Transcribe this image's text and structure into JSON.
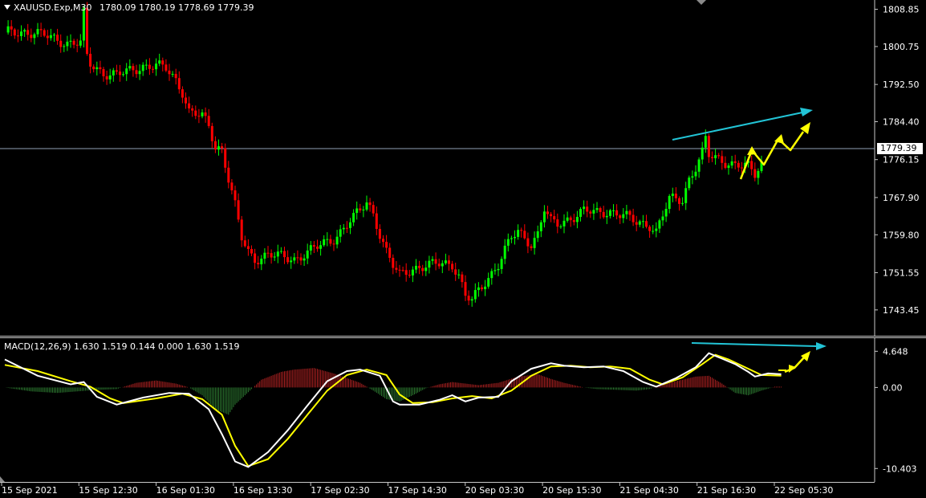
{
  "header": {
    "symbol_label": "XAUUSD.Exp,M30",
    "ohlc_label": "1780.09 1780.19 1778.69 1779.39"
  },
  "current_price_label": "1779.39",
  "macd_label": "MACD(12,26,9) 1.630 1.519 0.144 0.000 1.630 1.519",
  "colors": {
    "background": "#000000",
    "bull_candle": "#00ff00",
    "bear_candle": "#ff0000",
    "macd_line": "#ffffff",
    "signal_line": "#ffff00",
    "hist_positive": "#b22222",
    "hist_negative": "#2e7d32",
    "arrow_cyan": "#22c4d6",
    "arrow_yellow": "#ffff00",
    "price_line": "#8fa0b4"
  },
  "chart_data": [
    {
      "type": "candlestick",
      "title": "XAUUSD.Exp,M30",
      "y_ticks": [
        "1808.85",
        "1800.75",
        "1792.50",
        "1784.40",
        "1776.15",
        "1767.90",
        "1759.80",
        "1751.55",
        "1743.45"
      ],
      "ylim": [
        1741.5,
        1810.0
      ],
      "x_ticks": [
        "15 Sep 2021",
        "15 Sep 12:30",
        "16 Sep 01:30",
        "16 Sep 13:30",
        "17 Sep 02:30",
        "17 Sep 14:30",
        "20 Sep 03:30",
        "20 Sep 15:30",
        "21 Sep 04:30",
        "21 Sep 16:30",
        "22 Sep 05:30"
      ],
      "close_path": [
        [
          0,
          1803.8
        ],
        [
          6,
          1804.0
        ],
        [
          12,
          1803.2
        ],
        [
          19,
          1801.5
        ],
        [
          23,
          1801.5
        ],
        [
          24,
          1807.8
        ],
        [
          25,
          1798.5
        ],
        [
          26,
          1797.0
        ],
        [
          30,
          1795.0
        ],
        [
          34,
          1794.5
        ],
        [
          38,
          1795.5
        ],
        [
          42,
          1796.5
        ],
        [
          46,
          1796.5
        ],
        [
          49,
          1796.0
        ],
        [
          52,
          1793.5
        ],
        [
          54,
          1791.0
        ],
        [
          56,
          1786.5
        ],
        [
          60,
          1785.5
        ],
        [
          62,
          1783.5
        ],
        [
          64,
          1779.0
        ],
        [
          66,
          1778.5
        ],
        [
          68,
          1772.0
        ],
        [
          70,
          1766.0
        ],
        [
          72,
          1759.0
        ],
        [
          74,
          1756.0
        ],
        [
          76,
          1754.5
        ],
        [
          80,
          1755.5
        ],
        [
          84,
          1755.0
        ],
        [
          88,
          1754.5
        ],
        [
          92,
          1756.0
        ],
        [
          96,
          1757.5
        ],
        [
          100,
          1759.0
        ],
        [
          104,
          1762.0
        ],
        [
          108,
          1765.0
        ],
        [
          110,
          1767.0
        ],
        [
          112,
          1764.5
        ],
        [
          114,
          1760.0
        ],
        [
          116,
          1756.0
        ],
        [
          118,
          1753.0
        ],
        [
          120,
          1751.0
        ],
        [
          124,
          1752.5
        ],
        [
          128,
          1753.0
        ],
        [
          132,
          1753.5
        ],
        [
          136,
          1753.5
        ],
        [
          138,
          1751.0
        ],
        [
          140,
          1746.5
        ],
        [
          142,
          1745.5
        ],
        [
          144,
          1747.5
        ],
        [
          146,
          1749.5
        ],
        [
          148,
          1751.5
        ],
        [
          150,
          1753.5
        ],
        [
          152,
          1756.5
        ],
        [
          154,
          1759.0
        ],
        [
          156,
          1760.5
        ],
        [
          158,
          1759.0
        ],
        [
          160,
          1758.0
        ],
        [
          162,
          1760.0
        ],
        [
          164,
          1765.5
        ],
        [
          166,
          1762.5
        ],
        [
          168,
          1762.0
        ],
        [
          172,
          1763.5
        ],
        [
          176,
          1765.0
        ],
        [
          180,
          1764.5
        ],
        [
          184,
          1765.0
        ],
        [
          188,
          1764.0
        ],
        [
          192,
          1762.5
        ],
        [
          196,
          1762.0
        ],
        [
          198,
          1760.5
        ],
        [
          200,
          1764.0
        ],
        [
          202,
          1767.5
        ],
        [
          206,
          1767.5
        ],
        [
          208,
          1772.0
        ],
        [
          210,
          1774.5
        ],
        [
          212,
          1777.5
        ],
        [
          213,
          1780.5
        ],
        [
          214,
          1777.0
        ],
        [
          218,
          1776.0
        ],
        [
          222,
          1775.0
        ],
        [
          226,
          1774.5
        ],
        [
          228,
          1773.0
        ],
        [
          230,
          1775.5
        ]
      ]
    },
    {
      "type": "macd",
      "title": "MACD(12,26,9) 1.630 1.519 0.144 0.000 1.630 1.519",
      "y_ticks": [
        "4.648",
        "0.00",
        "-10.403"
      ],
      "ylim": [
        -11.2,
        5.3
      ],
      "macd": [
        [
          0,
          3.6
        ],
        [
          10,
          1.5
        ],
        [
          20,
          0.4
        ],
        [
          24,
          0.7
        ],
        [
          28,
          -1.2
        ],
        [
          34,
          -2.2
        ],
        [
          42,
          -1.3
        ],
        [
          50,
          -0.7
        ],
        [
          56,
          -0.8
        ],
        [
          62,
          -2.8
        ],
        [
          66,
          -6.0
        ],
        [
          70,
          -9.5
        ],
        [
          74,
          -10.2
        ],
        [
          80,
          -8.3
        ],
        [
          86,
          -5.5
        ],
        [
          92,
          -2.3
        ],
        [
          98,
          0.8
        ],
        [
          104,
          2.1
        ],
        [
          108,
          2.3
        ],
        [
          114,
          1.5
        ],
        [
          118,
          -1.8
        ],
        [
          120,
          -2.2
        ],
        [
          126,
          -2.2
        ],
        [
          132,
          -1.6
        ],
        [
          136,
          -1.0
        ],
        [
          140,
          -1.8
        ],
        [
          144,
          -1.3
        ],
        [
          150,
          -1.2
        ],
        [
          154,
          0.8
        ],
        [
          160,
          2.4
        ],
        [
          166,
          3.1
        ],
        [
          170,
          2.8
        ],
        [
          176,
          2.6
        ],
        [
          182,
          2.7
        ],
        [
          188,
          2.1
        ],
        [
          194,
          0.7
        ],
        [
          198,
          0.1
        ],
        [
          204,
          1.2
        ],
        [
          210,
          2.6
        ],
        [
          214,
          4.4
        ],
        [
          218,
          3.7
        ],
        [
          222,
          3.0
        ],
        [
          226,
          2.0
        ],
        [
          228,
          1.4
        ],
        [
          232,
          1.8
        ],
        [
          236,
          1.7
        ]
      ],
      "signal": [
        [
          0,
          2.9
        ],
        [
          10,
          2.1
        ],
        [
          20,
          0.8
        ],
        [
          26,
          0.1
        ],
        [
          32,
          -1.4
        ],
        [
          36,
          -2.0
        ],
        [
          46,
          -1.4
        ],
        [
          54,
          -0.8
        ],
        [
          60,
          -1.5
        ],
        [
          66,
          -3.5
        ],
        [
          70,
          -7.5
        ],
        [
          74,
          -10.1
        ],
        [
          80,
          -9.2
        ],
        [
          86,
          -6.6
        ],
        [
          92,
          -3.5
        ],
        [
          98,
          -0.4
        ],
        [
          104,
          1.6
        ],
        [
          110,
          2.3
        ],
        [
          116,
          1.6
        ],
        [
          120,
          -0.9
        ],
        [
          124,
          -2.0
        ],
        [
          130,
          -1.9
        ],
        [
          136,
          -1.4
        ],
        [
          142,
          -1.1
        ],
        [
          148,
          -1.4
        ],
        [
          154,
          -0.4
        ],
        [
          160,
          1.5
        ],
        [
          166,
          2.7
        ],
        [
          172,
          2.8
        ],
        [
          178,
          2.6
        ],
        [
          184,
          2.7
        ],
        [
          190,
          2.4
        ],
        [
          196,
          1.0
        ],
        [
          200,
          0.4
        ],
        [
          206,
          1.3
        ],
        [
          212,
          3.0
        ],
        [
          216,
          4.2
        ],
        [
          220,
          3.6
        ],
        [
          226,
          2.4
        ],
        [
          230,
          1.6
        ],
        [
          236,
          1.5
        ]
      ],
      "histogram": [
        [
          0,
          0.0
        ],
        [
          8,
          -0.5
        ],
        [
          16,
          -0.7
        ],
        [
          22,
          -0.5
        ],
        [
          28,
          -0.3
        ],
        [
          34,
          -0.2
        ],
        [
          40,
          0.6
        ],
        [
          46,
          0.9
        ],
        [
          52,
          0.5
        ],
        [
          56,
          0.0
        ],
        [
          60,
          -1.0
        ],
        [
          64,
          -2.8
        ],
        [
          68,
          -3.5
        ],
        [
          70,
          -2.2
        ],
        [
          74,
          -0.6
        ],
        [
          78,
          1.0
        ],
        [
          84,
          2.0
        ],
        [
          88,
          2.3
        ],
        [
          94,
          2.5
        ],
        [
          100,
          1.8
        ],
        [
          104,
          1.2
        ],
        [
          108,
          0.6
        ],
        [
          112,
          -0.4
        ],
        [
          116,
          -1.5
        ],
        [
          120,
          -1.8
        ],
        [
          124,
          -1.0
        ],
        [
          128,
          -0.1
        ],
        [
          132,
          0.4
        ],
        [
          136,
          0.7
        ],
        [
          140,
          0.5
        ],
        [
          144,
          0.3
        ],
        [
          150,
          0.6
        ],
        [
          156,
          1.4
        ],
        [
          162,
          1.7
        ],
        [
          166,
          1.1
        ],
        [
          170,
          0.6
        ],
        [
          176,
          0.0
        ],
        [
          180,
          -0.2
        ],
        [
          186,
          -0.3
        ],
        [
          192,
          -0.4
        ],
        [
          196,
          -0.2
        ],
        [
          200,
          0.4
        ],
        [
          206,
          1.0
        ],
        [
          210,
          1.4
        ],
        [
          214,
          1.5
        ],
        [
          218,
          0.5
        ],
        [
          222,
          -0.7
        ],
        [
          226,
          -1.0
        ],
        [
          230,
          -0.4
        ],
        [
          234,
          0.1
        ],
        [
          236,
          0.1
        ]
      ]
    }
  ]
}
